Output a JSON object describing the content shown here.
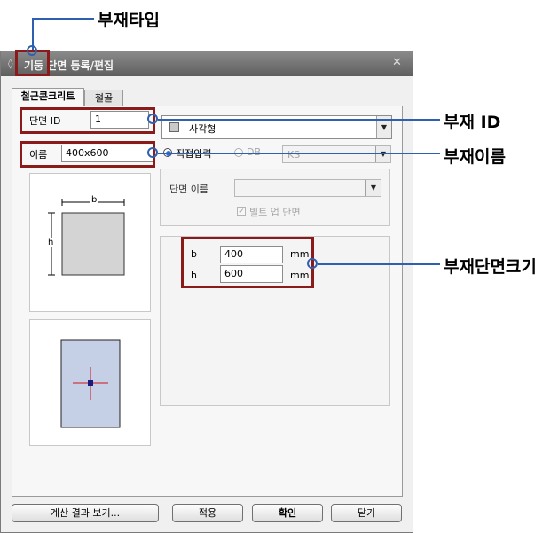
{
  "callouts": {
    "member_type": "부재타입",
    "member_id": "부재 ID",
    "member_name": "부재이름",
    "member_size": "부재단면크기"
  },
  "dialog": {
    "title": "기둥 단면 등록/편집",
    "tabs": [
      "철근콘크리트",
      "철골"
    ],
    "section_id_label": "단면 ID",
    "section_id_value": "1",
    "name_label": "이름",
    "name_value": "400x600",
    "shape_value": "사각형",
    "radio_direct": "직접입력",
    "radio_db": "DB",
    "db_value": "KS",
    "section_name_label": "단면 이름",
    "section_name_value": "",
    "built_up_label": "빌트 업 단면",
    "dims": [
      {
        "name": "b",
        "value": "400",
        "unit": "mm"
      },
      {
        "name": "h",
        "value": "600",
        "unit": "mm"
      }
    ],
    "preview_b": "b",
    "preview_h": "h",
    "buttons": {
      "calc": "계산 결과 보기...",
      "apply": "적용",
      "ok": "확인",
      "close": "닫기"
    }
  },
  "colors": {
    "highlight_box": "#8b1a1a",
    "callout_marker": "#2f60b0",
    "rect_fill": "#d4d4d4",
    "section_fill": "#c5cfe6",
    "crosshair": "#d01414"
  }
}
